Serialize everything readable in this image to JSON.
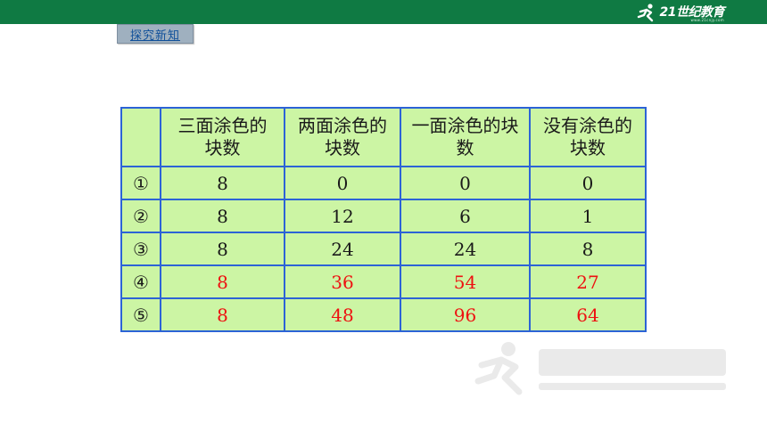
{
  "brand": {
    "name": "21世纪教育",
    "url": "www.21cnjy.com"
  },
  "section_tag": "探究新知",
  "table": {
    "headers": [
      "",
      "三面涂色的块数",
      "两面涂色的块数",
      "一面涂色的块数",
      "没有涂色的块数"
    ],
    "header_lines": [
      [
        "三面涂色的",
        "块数"
      ],
      [
        "两面涂色的",
        "块数"
      ],
      [
        "一面涂色的块",
        "数"
      ],
      [
        "没有涂色的",
        "块数"
      ]
    ],
    "rows": [
      {
        "index": "①",
        "values": [
          "8",
          "0",
          "0",
          "0"
        ],
        "highlight": false
      },
      {
        "index": "②",
        "values": [
          "8",
          "12",
          "6",
          "1"
        ],
        "highlight": false
      },
      {
        "index": "③",
        "values": [
          "8",
          "24",
          "24",
          "8"
        ],
        "highlight": false
      },
      {
        "index": "④",
        "values": [
          "8",
          "36",
          "54",
          "27"
        ],
        "highlight": true
      },
      {
        "index": "⑤",
        "values": [
          "8",
          "48",
          "96",
          "64"
        ],
        "highlight": true
      }
    ]
  },
  "colors": {
    "topbar": "#0f7a43",
    "table_fill": "#ccf5a4",
    "table_border": "#2c63d6",
    "highlight_text": "#ee1111"
  }
}
